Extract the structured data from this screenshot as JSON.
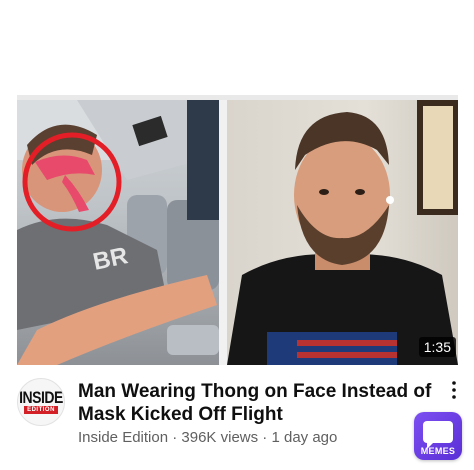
{
  "video": {
    "title": "Man Wearing Thong on Face Instead of Mask Kicked Off Flight",
    "channel": "Inside Edition",
    "views": "396K views",
    "age": "1 day ago",
    "duration": "1:35",
    "meta_separator": " · "
  },
  "channel_logo": {
    "top_text": "INSIDE",
    "bottom_text": "EDITION"
  },
  "watermark": {
    "label": "MEMES"
  },
  "icons": {
    "menu": "more-vert-icon",
    "watermark": "memes-app-icon"
  },
  "colors": {
    "title": "#0f0f0f",
    "meta": "#606060",
    "highlight_circle": "#e41e26",
    "watermark_purple": "#6a3ce6"
  }
}
